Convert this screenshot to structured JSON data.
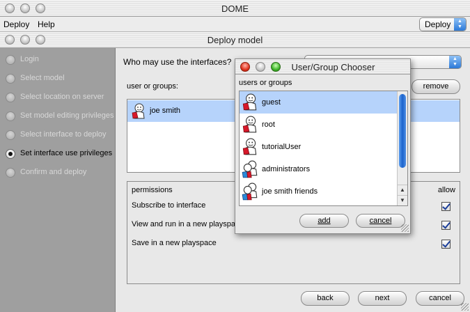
{
  "app": {
    "title": "DOME"
  },
  "menubar": {
    "deploy": "Deploy",
    "help": "Help",
    "mode_select": "Deploy"
  },
  "deploy_window": {
    "title": "Deploy model"
  },
  "steps": [
    {
      "label": "Login",
      "selected": false
    },
    {
      "label": "Select model",
      "selected": false
    },
    {
      "label": "Select location on server",
      "selected": false
    },
    {
      "label": "Set model editing privileges",
      "selected": false
    },
    {
      "label": "Select interface to deploy",
      "selected": false
    },
    {
      "label": "Set interface use privileges",
      "selected": true
    },
    {
      "label": "Confirm and deploy",
      "selected": false
    }
  ],
  "main": {
    "question": "Who may use the interfaces?",
    "users_label": "user or groups:",
    "remove_button": "remove",
    "user_list": [
      {
        "name": "joe smith",
        "icon": "user-icon"
      }
    ],
    "permissions": {
      "header": "permissions",
      "allow_header": "allow",
      "rows": [
        {
          "label": "Subscribe to interface",
          "allowed": true
        },
        {
          "label": "View and run in a new playspace",
          "allowed": true
        },
        {
          "label": "Save in a new playspace",
          "allowed": true
        }
      ]
    },
    "buttons": {
      "back": "back",
      "next": "next",
      "cancel": "cancel"
    }
  },
  "chooser": {
    "title": "User/Group Chooser",
    "list_label": "users or groups",
    "items": [
      {
        "name": "guest",
        "icon": "user-icon",
        "selected": true
      },
      {
        "name": "root",
        "icon": "user-icon",
        "selected": false
      },
      {
        "name": "tutorialUser",
        "icon": "user-icon",
        "selected": false
      },
      {
        "name": "administrators",
        "icon": "group-icon",
        "selected": false
      },
      {
        "name": "joe smith friends",
        "icon": "group-icon",
        "selected": false
      }
    ],
    "add_button": "add",
    "cancel_button": "cancel"
  },
  "colors": {
    "selection": "#b6d3fb",
    "sidebar": "#9f9f9f",
    "accent": "#2b79d8"
  }
}
